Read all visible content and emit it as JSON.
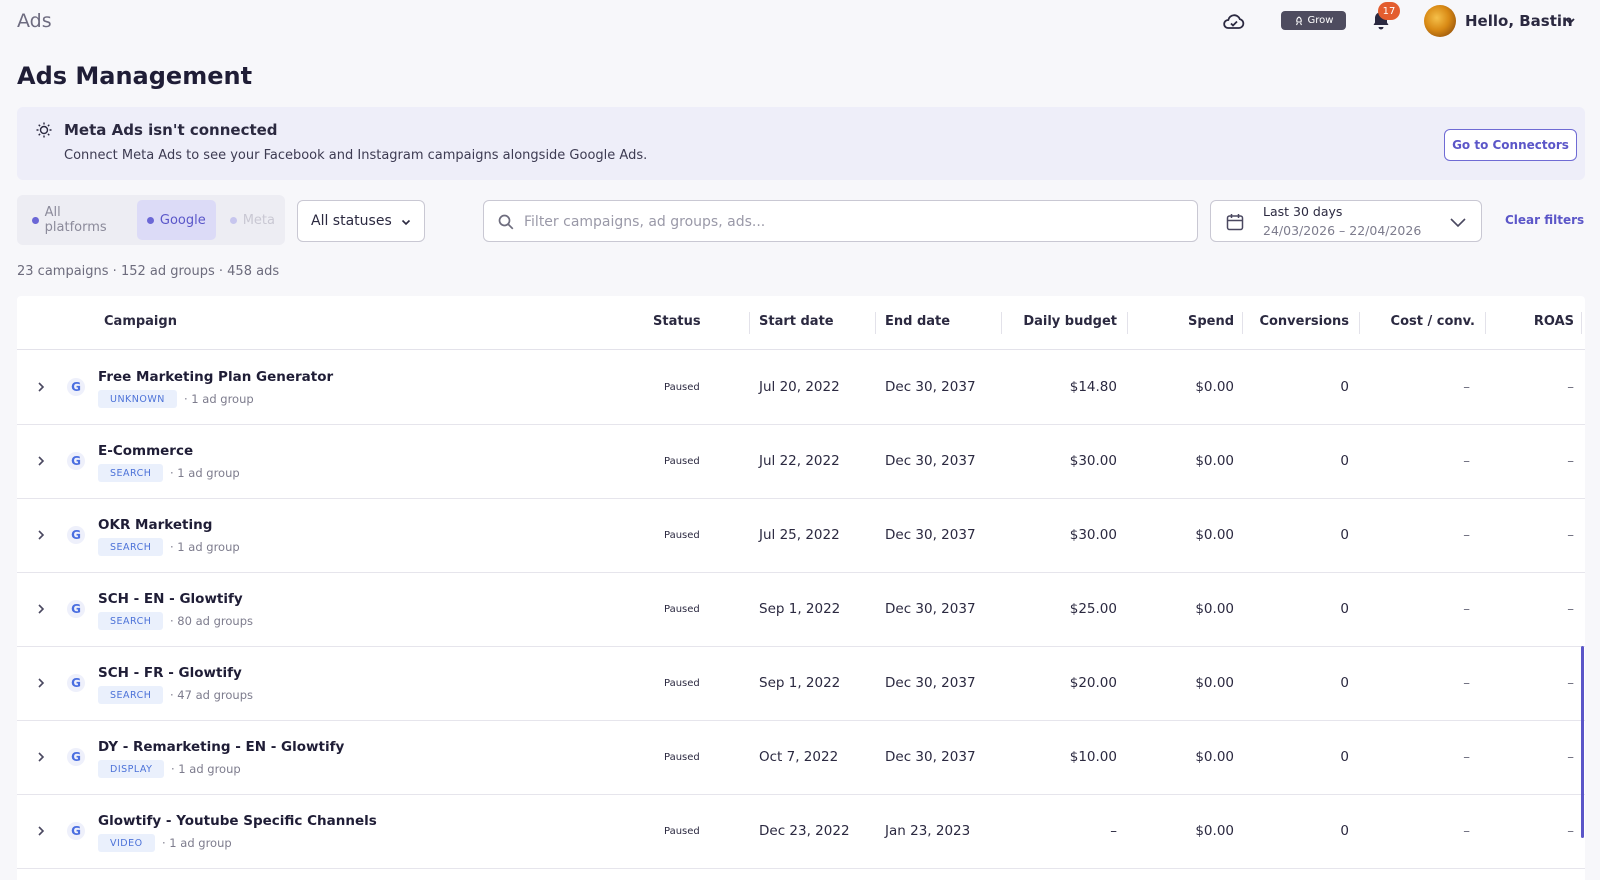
{
  "app": {
    "title": "Ads"
  },
  "topbar": {
    "grow_label": "Grow",
    "notification_count": "17",
    "greeting": "Hello, Bastin",
    "icons": [
      "cloud-sync-icon",
      "rocket-icon",
      "bell-icon",
      "chevron-down-icon"
    ]
  },
  "page": {
    "title": "Ads Management"
  },
  "notice": {
    "title": "Meta Ads isn't connected",
    "text": "Connect Meta Ads to see your Facebook and Instagram campaigns alongside Google Ads.",
    "button_label": "Go to Connectors"
  },
  "filters": {
    "platforms": [
      {
        "label": "All platforms",
        "state": "default"
      },
      {
        "label": "Google",
        "state": "active"
      },
      {
        "label": "Meta",
        "state": "disabled"
      }
    ],
    "status_label": "All statuses",
    "search_placeholder": "Filter campaigns, ad groups, ads...",
    "search_value": "",
    "date_label": "Last 30 days",
    "date_range": "24/03/2026 – 22/04/2026",
    "clear_label": "Clear filters"
  },
  "summary": "23 campaigns · 152 ad groups · 458 ads",
  "table": {
    "columns": {
      "campaign": "Campaign",
      "status": "Status",
      "start": "Start date",
      "end": "End date",
      "budget": "Daily budget",
      "spend": "Spend",
      "conversions": "Conversions",
      "cost_conv": "Cost / conv.",
      "roas": "ROAS"
    },
    "rows": [
      {
        "name": "Free Marketing Plan Generator",
        "type": "UNKNOWN",
        "groups": "· 1 ad group",
        "status": "Paused",
        "start": "Jul 20, 2022",
        "end": "Dec 30, 2037",
        "budget": "$14.80",
        "spend": "$0.00",
        "conversions": "0",
        "cost_conv": "–",
        "roas": "–"
      },
      {
        "name": "E-Commerce",
        "type": "SEARCH",
        "groups": "· 1 ad group",
        "status": "Paused",
        "start": "Jul 22, 2022",
        "end": "Dec 30, 2037",
        "budget": "$30.00",
        "spend": "$0.00",
        "conversions": "0",
        "cost_conv": "–",
        "roas": "–"
      },
      {
        "name": "OKR Marketing",
        "type": "SEARCH",
        "groups": "· 1 ad group",
        "status": "Paused",
        "start": "Jul 25, 2022",
        "end": "Dec 30, 2037",
        "budget": "$30.00",
        "spend": "$0.00",
        "conversions": "0",
        "cost_conv": "–",
        "roas": "–"
      },
      {
        "name": "SCH - EN - Glowtify",
        "type": "SEARCH",
        "groups": "· 80 ad groups",
        "status": "Paused",
        "start": "Sep 1, 2022",
        "end": "Dec 30, 2037",
        "budget": "$25.00",
        "spend": "$0.00",
        "conversions": "0",
        "cost_conv": "–",
        "roas": "–"
      },
      {
        "name": "SCH - FR - Glowtify",
        "type": "SEARCH",
        "groups": "· 47 ad groups",
        "status": "Paused",
        "start": "Sep 1, 2022",
        "end": "Dec 30, 2037",
        "budget": "$20.00",
        "spend": "$0.00",
        "conversions": "0",
        "cost_conv": "–",
        "roas": "–"
      },
      {
        "name": "DY - Remarketing - EN - Glowtify",
        "type": "DISPLAY",
        "groups": "· 1 ad group",
        "status": "Paused",
        "start": "Oct 7, 2022",
        "end": "Dec 30, 2037",
        "budget": "$10.00",
        "spend": "$0.00",
        "conversions": "0",
        "cost_conv": "–",
        "roas": "–"
      },
      {
        "name": "Glowtify - Youtube Specific Channels",
        "type": "VIDEO",
        "groups": "· 1 ad group",
        "status": "Paused",
        "start": "Dec 23, 2022",
        "end": "Jan 23, 2023",
        "budget": "–",
        "spend": "$0.00",
        "conversions": "0",
        "cost_conv": "–",
        "roas": "–"
      }
    ]
  },
  "colors": {
    "accent": "#5b56c8",
    "badge_bg": "#eaf0fc",
    "badge_text": "#4c72d8",
    "notification": "#e35d2f"
  }
}
